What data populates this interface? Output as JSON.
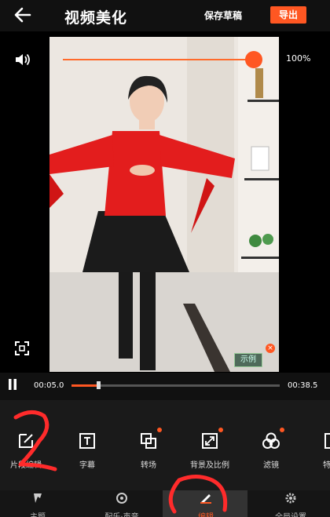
{
  "header": {
    "back_icon": "arrow-left-icon",
    "title": "视频美化",
    "save_draft": "保存草稿",
    "export": "导出",
    "accent": "#ff5722"
  },
  "preview": {
    "volume_icon": "speaker-icon",
    "volume_percent": "100%",
    "volume_level": 1.0,
    "fullscreen_icon": "fullscreen-icon",
    "sticker_text": "示例"
  },
  "playback": {
    "current": "00:05.0",
    "total": "00:38.5",
    "progress": 0.13
  },
  "tools": [
    {
      "label": "片段编辑",
      "icon": "edit-icon",
      "dot": false
    },
    {
      "label": "字幕",
      "icon": "text-icon",
      "dot": false
    },
    {
      "label": "转场",
      "icon": "transition-icon",
      "dot": true
    },
    {
      "label": "背景及比例",
      "icon": "ratio-icon",
      "dot": true
    },
    {
      "label": "滤镜",
      "icon": "filter-icon",
      "dot": true
    },
    {
      "label": "特",
      "icon": "effect-icon",
      "dot": false
    }
  ],
  "nav": [
    {
      "label": "主题",
      "icon": "theme-icon"
    },
    {
      "label": "配乐·声音",
      "icon": "music-icon"
    },
    {
      "label": "编辑",
      "icon": "edit-nav-icon"
    },
    {
      "label": "全局设置",
      "icon": "settings-icon"
    }
  ]
}
